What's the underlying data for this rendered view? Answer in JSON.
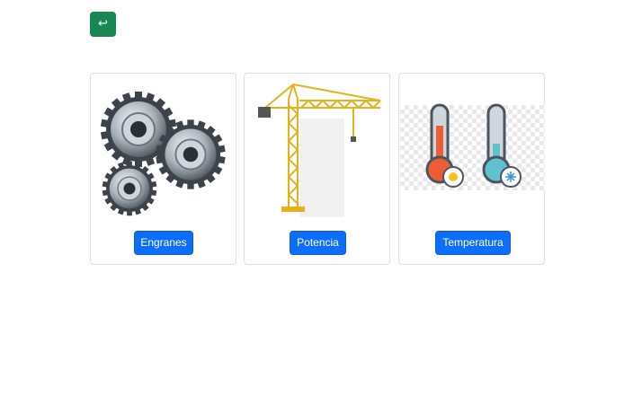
{
  "back_button": {
    "icon": "return-arrow-icon",
    "glyph": "↩",
    "color": "#198754"
  },
  "cards": [
    {
      "image": "gears-image",
      "label": "Engranes"
    },
    {
      "image": "tower-crane-image",
      "label": "Potencia"
    },
    {
      "image": "thermometers-image",
      "label": "Temperatura"
    }
  ],
  "colors": {
    "primary_button": "#0d6efd",
    "back_button": "#198754"
  }
}
